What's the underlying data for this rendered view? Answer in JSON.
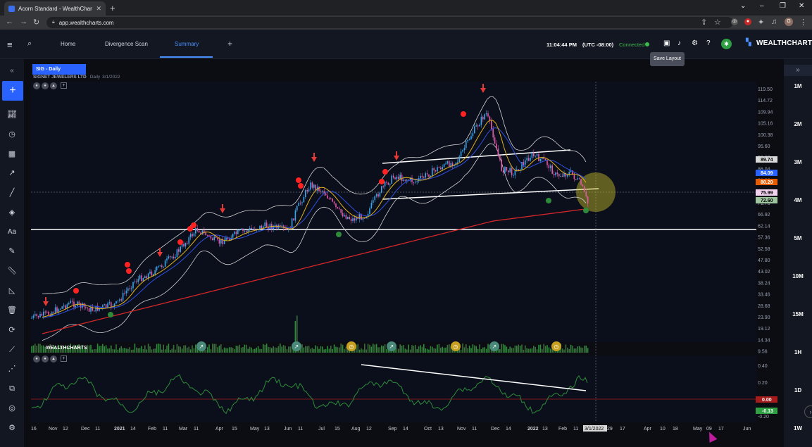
{
  "browser": {
    "tab_title": "Acorn Standard - WealthCharts",
    "url": "app.wealthcharts.com",
    "window_controls": [
      "⌄",
      "–",
      "❐",
      "✕"
    ],
    "profile_initial": "G"
  },
  "header": {
    "tabs": [
      {
        "label": "Home",
        "active": false
      },
      {
        "label": "Divergence Scan",
        "active": false
      },
      {
        "label": "Summary",
        "active": true
      }
    ],
    "time": "11:04:44 PM",
    "timezone": "(UTC -08:00)",
    "status": "Connected",
    "brand": "WEALTHCHARTS",
    "tooltip": "Save Layout",
    "accent_color": "#2962ff",
    "status_color": "#3fb950"
  },
  "chart": {
    "symbol_badge": "SIG - Daily",
    "company": "SIGNET JEWELERS LTD",
    "interval": "Daily",
    "date": "3/1/2022",
    "indicator_brand": "WEALTHCHARTS",
    "crosshair_date": "3/1/2022",
    "price_axis": [
      "119.50",
      "114.72",
      "109.94",
      "105.16",
      "100.38",
      "95.60",
      "90.82",
      "86.04",
      "81.26",
      "76.48",
      "71.70",
      "66.92",
      "62.14",
      "57.36",
      "52.58",
      "47.80",
      "43.02",
      "38.24",
      "33.46",
      "28.68",
      "23.90",
      "19.12",
      "14.34",
      "9.56"
    ],
    "price_tags": [
      {
        "label": "89.74",
        "bg": "#d9d9d9",
        "fg": "#000000"
      },
      {
        "label": "84.09",
        "bg": "#2962ff",
        "fg": "#ffffff"
      },
      {
        "label": "80.20",
        "bg": "#e65c00",
        "fg": "#ffffff"
      },
      {
        "label": "75.99",
        "bg": "#f3d2f0",
        "fg": "#000000"
      },
      {
        "label": "72.60",
        "bg": "#9fc59f",
        "fg": "#000000"
      }
    ],
    "osc_axis": [
      "0.40",
      "0.20",
      "-0.20"
    ],
    "osc_tags": [
      {
        "label": "0.00",
        "bg": "#a61b1b",
        "fg": "#ffffff"
      },
      {
        "label": "-0.13",
        "bg": "#2ea043",
        "fg": "#ffffff"
      }
    ],
    "time_axis": [
      "16",
      "Nov",
      "12",
      "Dec",
      "11",
      "2021",
      "14",
      "Feb",
      "11",
      "Mar",
      "11",
      "Apr",
      "15",
      "May",
      "13",
      "Jun",
      "11",
      "Jul",
      "15",
      "Aug",
      "12",
      "Sep",
      "14",
      "Oct",
      "13",
      "Nov",
      "11",
      "Dec",
      "14",
      "2022",
      "13",
      "Feb",
      "11",
      "29",
      "17",
      "Apr",
      "10",
      "18",
      "May",
      "09",
      "17",
      "Jun"
    ]
  },
  "sidebar_right": {
    "timeframes": [
      "1M",
      "2M",
      "3M",
      "4M",
      "5M",
      "10M",
      "15M",
      "1H",
      "1D",
      "1W"
    ]
  },
  "tools_left": [
    "collapse",
    "add",
    "indicators",
    "clock",
    "calendar",
    "trend",
    "line",
    "brush",
    "text",
    "pen",
    "ruler",
    "measure",
    "trash",
    "refresh",
    "chart",
    "node",
    "copy",
    "target",
    "settings"
  ]
}
